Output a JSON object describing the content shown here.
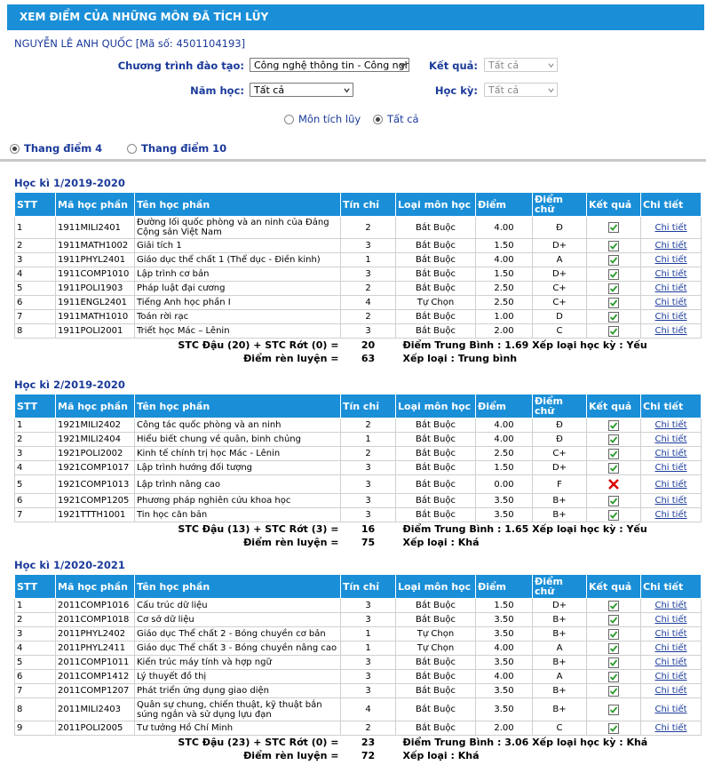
{
  "page": {
    "title": "XEM ĐIỂM CỦA NHỮNG MÔN ĐÃ TÍCH LŨY",
    "student": "NGUYỄN LÊ ANH QUỐC [Mã số: 4501104193]"
  },
  "filters": {
    "program_label": "Chương trình đào tạo:",
    "program_value": "Công nghệ thông tin - Công ngh",
    "result_label": "Kết quả:",
    "result_value": "Tất cả",
    "year_label": "Năm học:",
    "year_value": "Tất cả",
    "term_label": "Học kỳ:",
    "term_value": "Tất cả",
    "radio_accumulated": "Môn tích lũy",
    "radio_all": "Tất cả",
    "scale4": "Thang điểm 4",
    "scale10": "Thang điểm 10"
  },
  "headers": [
    "STT",
    "Mã học phần",
    "Tên học phần",
    "Tín chỉ",
    "Loại môn học",
    "Điểm",
    "Điểm chữ",
    "Kết quả",
    "Chi tiết"
  ],
  "detail_link": "Chi tiết",
  "semesters": [
    {
      "title": "Học kì 1/2019-2020",
      "rows": [
        [
          "1",
          "1911MILI2401",
          "Đường lối quốc phòng và an ninh của Đảng Cộng sản Việt Nam",
          "2",
          "Bắt Buộc",
          "4.00",
          "Đ",
          "pass"
        ],
        [
          "2",
          "1911MATH1002",
          "Giải tích 1",
          "3",
          "Bắt Buộc",
          "1.50",
          "D+",
          "pass"
        ],
        [
          "3",
          "1911PHYL2401",
          "Giáo dục thể chất 1 (Thể dục - Điền kinh)",
          "1",
          "Bắt Buộc",
          "4.00",
          "A",
          "pass"
        ],
        [
          "4",
          "1911COMP1010",
          "Lập trình cơ bản",
          "3",
          "Bắt Buộc",
          "1.50",
          "D+",
          "pass"
        ],
        [
          "5",
          "1911POLI1903",
          "Pháp luật đại cương",
          "2",
          "Bắt Buộc",
          "2.50",
          "C+",
          "pass"
        ],
        [
          "6",
          "1911ENGL2401",
          "Tiếng Anh học phần I",
          "4",
          "Tự Chọn",
          "2.50",
          "C+",
          "pass"
        ],
        [
          "7",
          "1911MATH1010",
          "Toán rời rạc",
          "2",
          "Bắt Buộc",
          "1.00",
          "D",
          "pass"
        ],
        [
          "8",
          "1911POLI2001",
          "Triết học Mác – Lênin",
          "3",
          "Bắt Buộc",
          "2.00",
          "C",
          "pass"
        ]
      ],
      "sum_label": "STC Đậu (20) + STC Rớt (0) =",
      "sum_value": "20",
      "gpa_text": "Điểm Trung Bình : 1.69 Xếp loại học kỳ : Yếu",
      "conduct_label": "Điểm rèn luyện =",
      "conduct_value": "63",
      "conduct_text": "Xếp loại : Trung bình"
    },
    {
      "title": "Học kì 2/2019-2020",
      "rows": [
        [
          "1",
          "1921MILI2402",
          "Công tác quốc phòng và an ninh",
          "2",
          "Bắt Buộc",
          "4.00",
          "Đ",
          "pass"
        ],
        [
          "2",
          "1921MILI2404",
          "Hiểu biết chung về quân, binh chủng",
          "1",
          "Bắt Buộc",
          "4.00",
          "Đ",
          "pass"
        ],
        [
          "3",
          "1921POLI2002",
          "Kinh tế chính trị học Mác - Lênin",
          "2",
          "Bắt Buộc",
          "2.50",
          "C+",
          "pass"
        ],
        [
          "4",
          "1921COMP1017",
          "Lập trình hướng đối tượng",
          "3",
          "Bắt Buộc",
          "1.50",
          "D+",
          "pass"
        ],
        [
          "5",
          "1921COMP1013",
          "Lập trình nâng cao",
          "3",
          "Bắt Buộc",
          "0.00",
          "F",
          "fail"
        ],
        [
          "6",
          "1921COMP1205",
          "Phương pháp nghiên cứu khoa học",
          "3",
          "Bắt Buộc",
          "3.50",
          "B+",
          "pass"
        ],
        [
          "7",
          "1921TTTH1001",
          "Tin học căn bản",
          "3",
          "Bắt Buộc",
          "3.50",
          "B+",
          "pass"
        ]
      ],
      "sum_label": "STC Đậu (13) + STC Rớt (3) =",
      "sum_value": "16",
      "gpa_text": "Điểm Trung Bình : 1.65 Xếp loại học kỳ : Yếu",
      "conduct_label": "Điểm rèn luyện =",
      "conduct_value": "75",
      "conduct_text": "Xếp loại : Khá"
    },
    {
      "title": "Học kì 1/2020-2021",
      "rows": [
        [
          "1",
          "2011COMP1016",
          "Cấu trúc dữ liệu",
          "3",
          "Bắt Buộc",
          "1.50",
          "D+",
          "pass"
        ],
        [
          "2",
          "2011COMP1018",
          "Cơ sở dữ liệu",
          "3",
          "Bắt Buộc",
          "3.50",
          "B+",
          "pass"
        ],
        [
          "3",
          "2011PHYL2402",
          "Giáo dục Thể chất 2 - Bóng chuyền cơ bản",
          "1",
          "Tự Chọn",
          "3.50",
          "B+",
          "pass"
        ],
        [
          "4",
          "2011PHYL2411",
          "Giáo dục Thể chất 3 - Bóng chuyền nâng cao",
          "1",
          "Tự Chọn",
          "4.00",
          "A",
          "pass"
        ],
        [
          "5",
          "2011COMP1011",
          "Kiến trúc máy tính và hợp ngữ",
          "3",
          "Bắt Buộc",
          "3.50",
          "B+",
          "pass"
        ],
        [
          "6",
          "2011COMP1412",
          "Lý thuyết đồ thị",
          "3",
          "Bắt Buộc",
          "4.00",
          "A",
          "pass"
        ],
        [
          "7",
          "2011COMP1207",
          "Phát triển ứng dụng giao diện",
          "3",
          "Bắt Buộc",
          "3.50",
          "B+",
          "pass"
        ],
        [
          "8",
          "2011MILI2403",
          "Quân sự chung, chiến thuật, kỹ thuật bắn súng ngắn và sử dụng lựu đạn",
          "4",
          "Bắt Buộc",
          "3.50",
          "B+",
          "pass"
        ],
        [
          "9",
          "2011POLI2005",
          "Tư tưởng Hồ Chí Minh",
          "2",
          "Bắt Buộc",
          "2.00",
          "C",
          "pass"
        ]
      ],
      "sum_label": "STC Đậu (23) + STC Rớt (0) =",
      "sum_value": "23",
      "gpa_text": "Điểm Trung Bình : 3.06 Xếp loại học kỳ : Khá",
      "conduct_label": "Điểm rèn luyện =",
      "conduct_value": "72",
      "conduct_text": "Xếp loại : Khá"
    }
  ]
}
